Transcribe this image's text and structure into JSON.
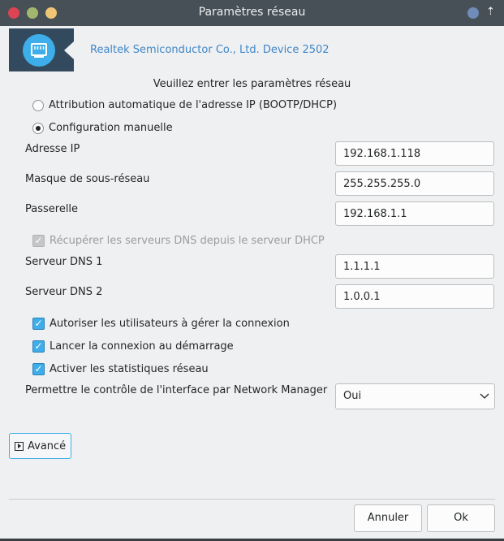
{
  "window": {
    "title": "Paramètres réseau"
  },
  "header": {
    "device_name": "Realtek Semiconductor Co., Ltd. Device 2502",
    "logo_icon": "network-card-icon"
  },
  "prompt": "Veuillez entrer les paramètres réseau",
  "mode": {
    "auto_label": "Attribution automatique de l'adresse IP (BOOTP/DHCP)",
    "manual_label": "Configuration manuelle",
    "selected": "manual"
  },
  "fields": {
    "ip_label": "Adresse IP",
    "ip_value": "192.168.1.118",
    "mask_label": "Masque de sous-réseau",
    "mask_value": "255.255.255.0",
    "gateway_label": "Passerelle",
    "gateway_value": "192.168.1.1",
    "dns_dhcp_label": "Récupérer les serveurs DNS depuis le serveur DHCP",
    "dns1_label": "Serveur DNS 1",
    "dns1_value": "1.1.1.1",
    "dns2_label": "Serveur DNS 2",
    "dns2_value": "1.0.0.1"
  },
  "options": {
    "allow_users_label": "Autoriser les utilisateurs à gérer la connexion",
    "start_boot_label": "Lancer la connexion au démarrage",
    "stats_label": "Activer les statistiques réseau"
  },
  "nm": {
    "label": "Permettre le contrôle de l'interface par Network Manager",
    "value": "Oui"
  },
  "advanced": {
    "label": "Avancé"
  },
  "buttons": {
    "cancel": "Annuler",
    "ok": "Ok"
  },
  "colors": {
    "accent": "#3daee9",
    "titlebar": "#475057",
    "header_band": "#334a5e",
    "link": "#3f86c8"
  }
}
